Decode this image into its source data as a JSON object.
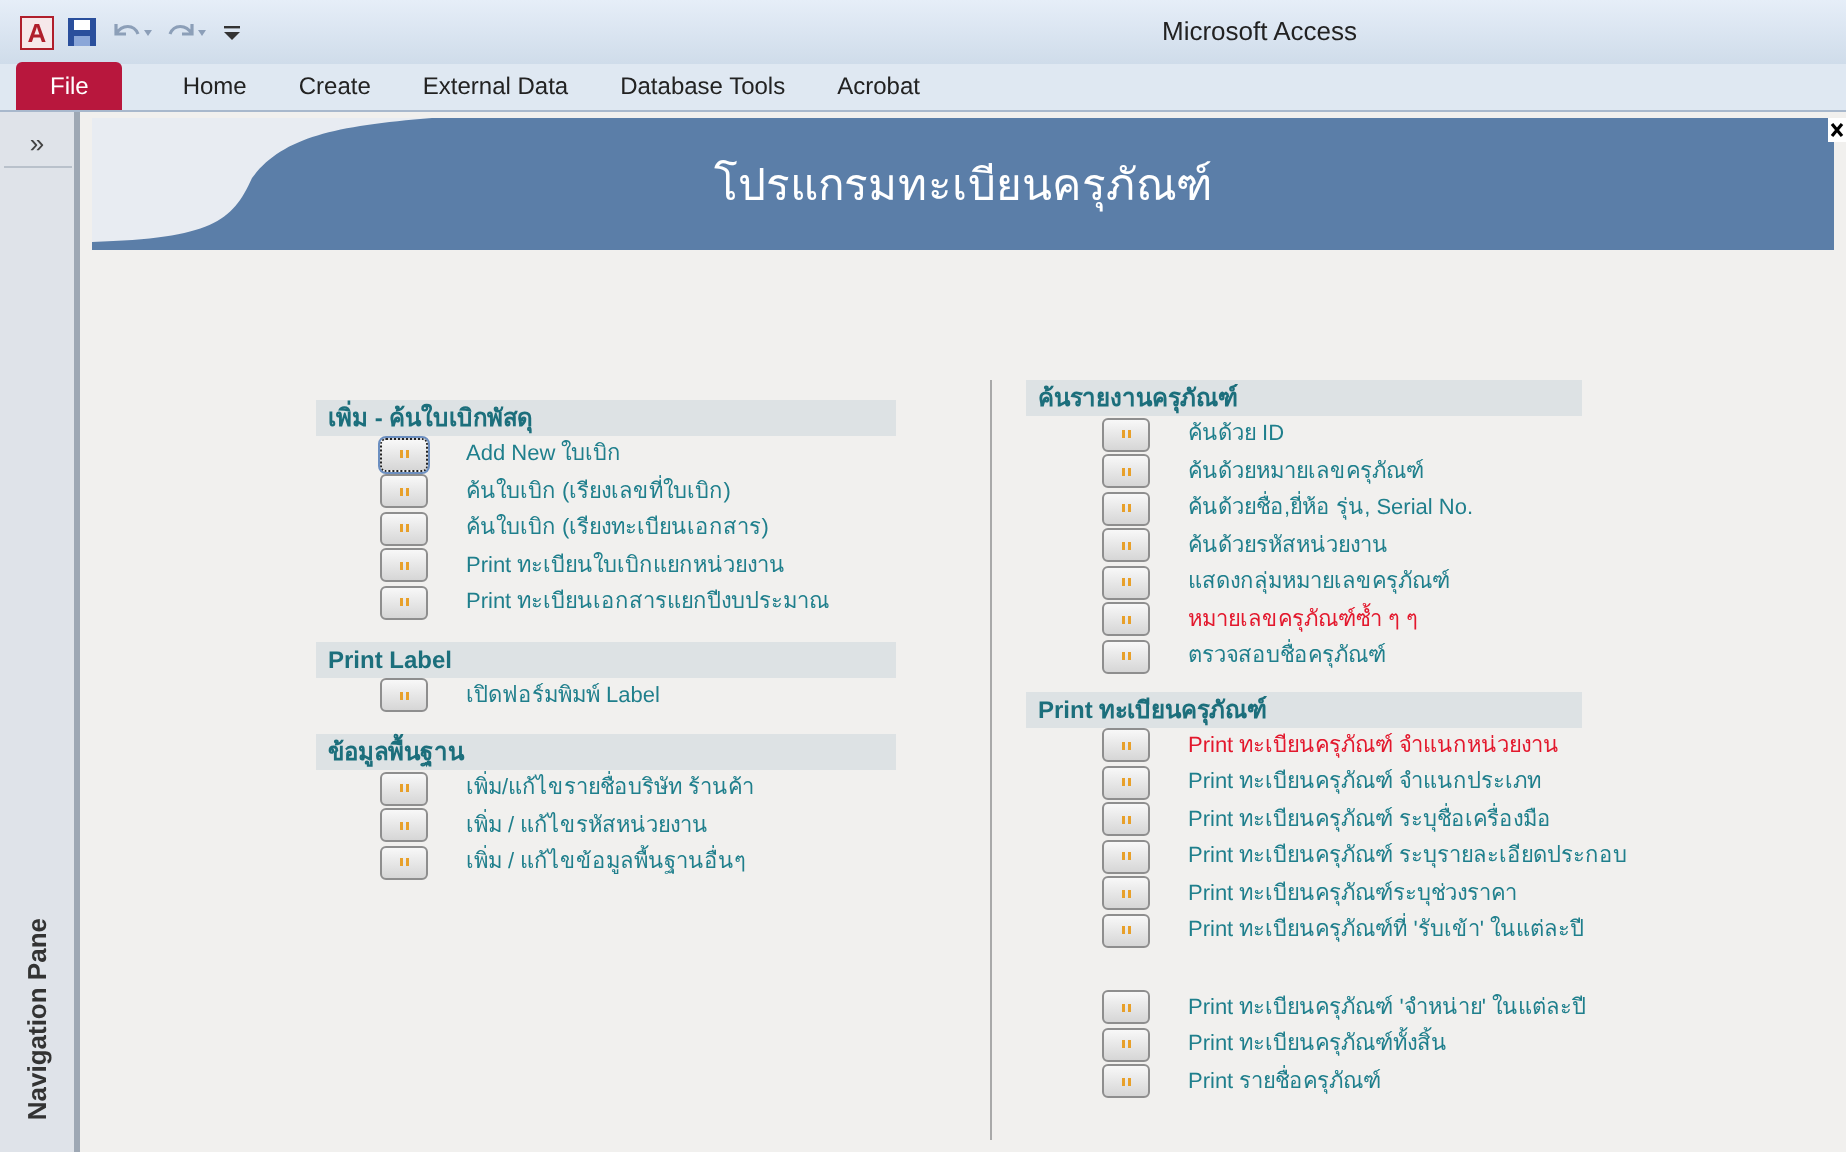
{
  "window": {
    "app_icon": "A",
    "title": "Microsoft Access"
  },
  "ribbon_tabs": [
    {
      "label": "File",
      "selected": true
    },
    {
      "label": "Home",
      "selected": false
    },
    {
      "label": "Create",
      "selected": false
    },
    {
      "label": "External Data",
      "selected": false
    },
    {
      "label": "Database Tools",
      "selected": false
    },
    {
      "label": "Acrobat",
      "selected": false
    }
  ],
  "navigation_pane": {
    "toggle": "»",
    "label": "Navigation Pane"
  },
  "form": {
    "title": "โปรแกรมทะเบียนครุภัณฑ์",
    "columns": [
      {
        "sections": [
          {
            "heading": "เพิ่ม - ค้นใบเบิกพัสดุ",
            "items": [
              {
                "label": "Add New ใบเบิก",
                "focused": true,
                "color": "#1f7f8c"
              },
              {
                "label": "ค้นใบเบิก (เรียงเลขที่ใบเบิก)",
                "focused": false,
                "color": "#1f7f8c"
              },
              {
                "label": "ค้นใบเบิก (เรียงทะเบียนเอกสาร)",
                "focused": false,
                "color": "#1f7f8c"
              },
              {
                "label": "Print ทะเบียนใบเบิกแยกหน่วยงาน",
                "focused": false,
                "color": "#1f7f8c"
              },
              {
                "label": "Print ทะเบียนเอกสารแยกปีงบประมาณ",
                "focused": false,
                "color": "#1f7f8c"
              }
            ]
          },
          {
            "heading": "Print Label",
            "items": [
              {
                "label": "เปิดฟอร์มพิมพ์ Label",
                "focused": false,
                "color": "#1f7f8c"
              }
            ]
          },
          {
            "heading": "ข้อมูลพื้นฐาน",
            "items": [
              {
                "label": "เพิ่ม/แก้ไขรายชื่อบริษัท ร้านค้า",
                "focused": false,
                "color": "#1f7f8c"
              },
              {
                "label": "เพิ่ม / แก้ไขรหัสหน่วยงาน",
                "focused": false,
                "color": "#1f7f8c"
              },
              {
                "label": "เพิ่ม / แก้ไขข้อมูลพื้นฐานอื่นๆ",
                "focused": false,
                "color": "#1f7f8c"
              }
            ]
          }
        ]
      },
      {
        "sections": [
          {
            "heading": "ค้นรายงานครุภัณฑ์",
            "items": [
              {
                "label": "ค้นด้วย ID",
                "focused": false,
                "color": "#1f7f8c"
              },
              {
                "label": "ค้นด้วยหมายเลขครุภัณฑ์",
                "focused": false,
                "color": "#1f7f8c"
              },
              {
                "label": "ค้นด้วยชื่อ,ยี่ห้อ รุ่น, Serial No.",
                "focused": false,
                "color": "#1f7f8c"
              },
              {
                "label": "ค้นด้วยรหัสหน่วยงาน",
                "focused": false,
                "color": "#1f7f8c"
              },
              {
                "label": "แสดงกลุ่มหมายเลขครุภัณฑ์",
                "focused": false,
                "color": "#1f7f8c"
              },
              {
                "label": "หมายเลขครุภัณฑ์ซ้ำ ๆ ๆ",
                "focused": false,
                "color": "#e3182d"
              },
              {
                "label": "ตรวจสอบชื่อครุภัณฑ์",
                "focused": false,
                "color": "#1f7f8c"
              }
            ]
          },
          {
            "heading": "Print ทะเบียนครุภัณฑ์",
            "items": [
              {
                "label": "Print ทะเบียนครุภัณฑ์ จำแนกหน่วยงาน",
                "focused": false,
                "color": "#e3182d"
              },
              {
                "label": "Print ทะเบียนครุภัณฑ์ จำแนกประเภท",
                "focused": false,
                "color": "#1f7f8c"
              },
              {
                "label": "Print ทะเบียนครุภัณฑ์ ระบุชื่อเครื่องมือ",
                "focused": false,
                "color": "#1f7f8c"
              },
              {
                "label": "Print ทะเบียนครุภัณฑ์ ระบุรายละเอียดประกอบ",
                "focused": false,
                "color": "#1f7f8c"
              },
              {
                "label": "Print ทะเบียนครุภัณฑ์ระบุช่วงราคา",
                "focused": false,
                "color": "#1f7f8c"
              },
              {
                "label": "Print ทะเบียนครุภัณฑ์ที่ 'รับเข้า' ในแต่ละปี",
                "focused": false,
                "color": "#1f7f8c"
              },
              {
                "label": "Print ทะเบียนครุภัณฑ์ 'จำหน่าย' ในแต่ละปี",
                "focused": false,
                "color": "#1f7f8c",
                "gap_before": true
              },
              {
                "label": "Print ทะเบียนครุภัณฑ์ทั้งสิ้น",
                "focused": false,
                "color": "#1f7f8c"
              },
              {
                "label": "Print รายชื่อครุภัณฑ์",
                "focused": false,
                "color": "#1f7f8c"
              }
            ]
          }
        ]
      }
    ]
  }
}
